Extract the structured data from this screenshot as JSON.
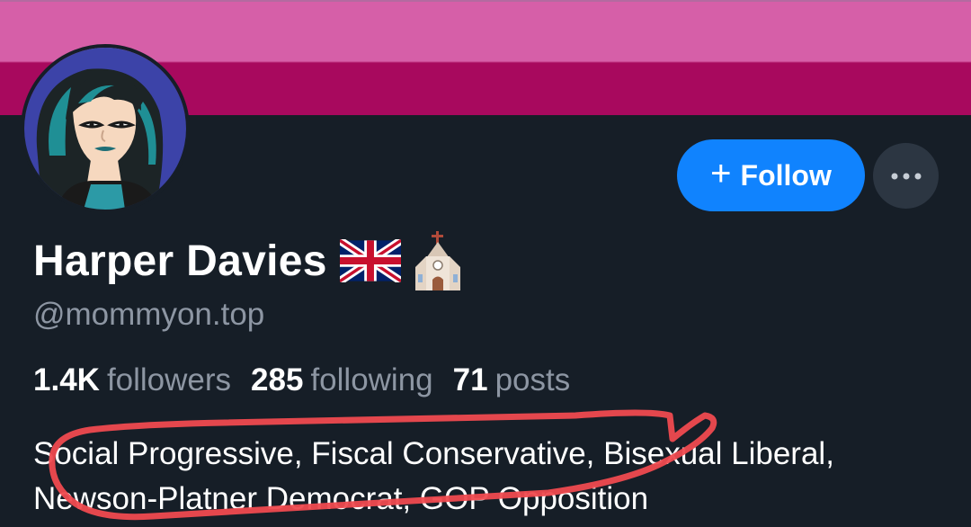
{
  "profile": {
    "display_name": "Harper Davies",
    "name_emojis": [
      "uk-flag-emoji",
      "church-emoji"
    ],
    "handle": "@mommyon.top",
    "bio": "Social Progressive, Fiscal Conservative, Bisexual Liberal, Newson-Platner Democrat, GOP Opposition"
  },
  "stats": {
    "followers_count": "1.4K",
    "followers_label": "followers",
    "following_count": "285",
    "following_label": "following",
    "posts_count": "71",
    "posts_label": "posts"
  },
  "actions": {
    "follow_icon": "+",
    "follow_label": "Follow",
    "more_icon": "ellipsis-icon"
  },
  "colors": {
    "background": "#161e27",
    "banner_top": "#d65fa8",
    "banner_bottom": "#a8095e",
    "accent": "#1083fe",
    "secondary_text": "#8d96a3",
    "annotation": "#ef4a4f"
  }
}
